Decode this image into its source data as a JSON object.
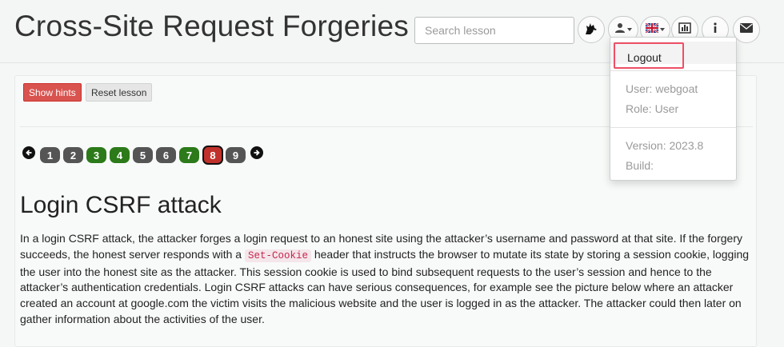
{
  "header": {
    "title": "Cross-Site Request Forgeries",
    "search_placeholder": "Search lesson",
    "icons": [
      "wolf-icon",
      "user-icon",
      "uk-flag-icon",
      "chart-icon",
      "info-icon",
      "envelope-icon"
    ]
  },
  "user_menu": {
    "logout_label": "Logout",
    "user_text": "User: webgoat",
    "role_text": "Role: User",
    "version_text": "Version: 2023.8",
    "build_text": "Build:"
  },
  "lesson": {
    "show_hints_label": "Show hints",
    "reset_label": "Reset lesson",
    "pages": [
      {
        "label": "1",
        "status": "default"
      },
      {
        "label": "2",
        "status": "default"
      },
      {
        "label": "3",
        "status": "solved"
      },
      {
        "label": "4",
        "status": "solved"
      },
      {
        "label": "5",
        "status": "default"
      },
      {
        "label": "6",
        "status": "default"
      },
      {
        "label": "7",
        "status": "solved"
      },
      {
        "label": "8",
        "status": "current"
      },
      {
        "label": "9",
        "status": "default"
      }
    ],
    "heading": "Login CSRF attack",
    "para_part1": "In a login CSRF attack, the attacker forges a login request to an honest site using the attacker’s username and password at that site. If the forgery succeeds, the honest server responds with a ",
    "code_text": "Set-Cookie",
    "para_part2": " header that instructs the browser to mutate its state by storing a session cookie, logging the user into the honest site as the attacker. This session cookie is used to bind subsequent requests to the user’s session and hence to the attacker’s authentication credentials. Login CSRF attacks can have serious consequences, for example see the picture below where an attacker created an account at google.com the victim visits the malicious website and the user is logged in as the attacker. The attacker could then later on gather information about the activities of the user."
  },
  "colors": {
    "hints_button": "#d9534f",
    "page_solved": "#2c7a1a",
    "page_current": "#c0312b",
    "page_default": "#555555",
    "highlight_border": "#ee4f66"
  }
}
